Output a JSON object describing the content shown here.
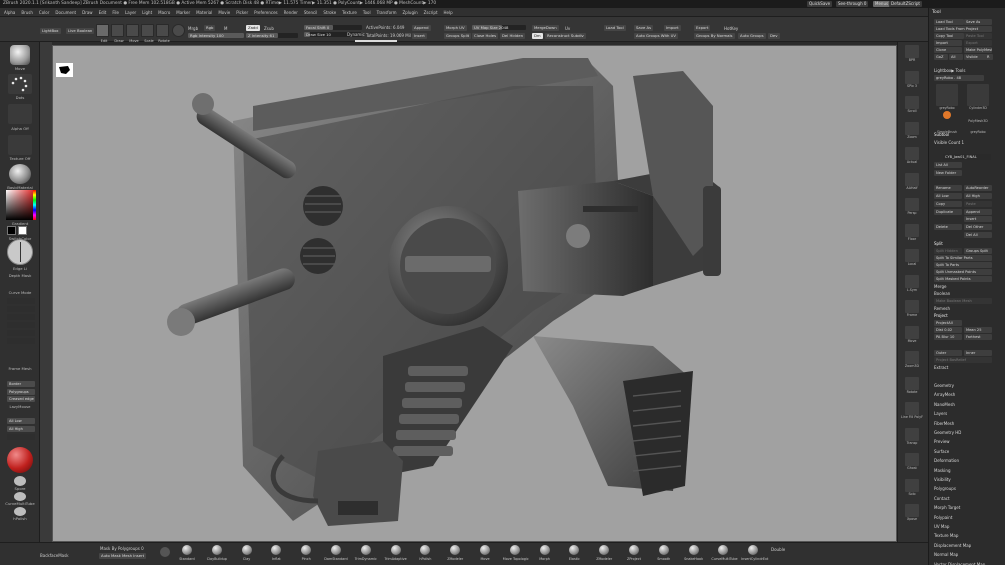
{
  "titlebar": {
    "title": "ZBrush 2020.1.1 [Srikanth Sandeep]   ZBrush Document    ● Free Mem 102.518GB ● Active Mem 5267 ● Scratch Disk 48 ● RTime▶ 11.575 Timer▶ 11.351 ● PolyCount▶ 1446.068 MP ● MeshCount▶ 170",
    "quicksave": "QuickSave",
    "seethrough": "See-through  0",
    "menus_label": "Menus",
    "default_script": "DefaultZScript"
  },
  "menubar": [
    "Alpha",
    "Brush",
    "Color",
    "Document",
    "Draw",
    "Edit",
    "File",
    "Layer",
    "Light",
    "Macro",
    "Marker",
    "Material",
    "Movie",
    "Picker",
    "Preferences",
    "Render",
    "Stencil",
    "Stroke",
    "Texture",
    "Tool",
    "Transform",
    "Zplugin",
    "Zscript",
    "Help"
  ],
  "topshelf": {
    "lightbox": "LightBox",
    "live_boolean": "Live Boolean",
    "edit": "Edit",
    "draw": "Draw",
    "move": "Move",
    "scale": "Scale",
    "rotate": "Rotate",
    "mrgb": "Mrgb",
    "rgb": "Rgb",
    "m": "M",
    "zadd": "Zadd",
    "zsub": "Zsub",
    "rgb_intensity": "Rgb Intensity 100",
    "z_intensity": "Z Intensity 61",
    "focal_shift": "Focal Shift 0",
    "draw_size": "Draw Size 10",
    "dynamic": "Dynamic",
    "active_points": "ActivePoints: 6.049",
    "total_points": "TotalPoints: 19.069 Mil",
    "append": "Append",
    "insert": "Insert",
    "morph_uv": "Morph UV",
    "uv_map_size": "UV Map Size 2048",
    "merge_down": "MergeDown",
    "uv": "Uv",
    "load_tool": "Load Tool",
    "save_as": "Save As",
    "import": "Import",
    "export": "Export",
    "hotkey": "HotKey",
    "save_as_2": "Save As",
    "goz": "GoZ",
    "all": "All",
    "visible": "Visible",
    "groups_split": "Groups Split",
    "close_holes": "Close Holes",
    "del_hidden": "Del Hidden",
    "dm": "Dm",
    "reconstruct": "Reconstruct Subdiv",
    "auto_groups_uv": "Auto Groups With UV",
    "groups_by_normals": "Groups By Normals",
    "auto_groups": "Auto Groups",
    "dev": "Dev"
  },
  "leftshelf": {
    "brush_label": "Move",
    "stroke_label": "Dots",
    "alpha_label": "Alpha Off",
    "texture_label": "Texture Off",
    "material_label": "BasicMaterial",
    "gradient_label": "Gradient",
    "switch_color": "SwitchColor",
    "alternate": "Alternate",
    "edge_label": "Edge Li",
    "depth_mask": "Depth Mask",
    "curve_mode": "Curve Mode",
    "frame_mesh": "Frame Mesh",
    "border": "Border",
    "polygroups": "Polygroups",
    "creased_edge": "Creased edge",
    "lazy_mouse": "LazyMouse",
    "all_low": "All Low",
    "all_high": "All High",
    "spore": "Spore",
    "curve_multi_tube": "CurveMultiTube",
    "hpolish": "hPolish"
  },
  "rightshelf": [
    "BPR",
    "SPix 3",
    "Scroll",
    "Zoom",
    "Actual",
    "AAHalf",
    "Persp",
    "Floor",
    "Local",
    "L.Sym",
    "Frame",
    "Move",
    "Zoom3D",
    "Rotate",
    "Line Fill PolyF",
    "Transp",
    "Ghost",
    "Solo",
    "Xpose"
  ],
  "tray": {
    "title": "Tool",
    "top_buttons": [
      "Load Tool",
      "Save As",
      "Load Tools From Project",
      "Copy Tool",
      "Paste Tool",
      "Import",
      "Export",
      "Clone",
      "Make PolyMesh3D",
      "GoZ",
      "All",
      "Visible",
      "R"
    ],
    "lightbox_tools": "Lightbox▶ Tools",
    "greyrobo": "greyRobo . 48",
    "thumbs": [
      "greyRobo",
      "Cylinder3D",
      "PolyMesh3D",
      "SimpleBrush",
      "greyRobo"
    ],
    "subtool_header": "Subtool",
    "visible_count": "Visible Count 1",
    "subtool_name": "CYB_Jaw01_FINAL",
    "list_all": "List All",
    "new_folder": "New Folder",
    "rename": "Rename",
    "autoreorder": "AutoReorder",
    "all_low": "All Low",
    "all_high": "All High",
    "copy": "Copy",
    "paste": "Paste",
    "duplicate": "Duplicate",
    "append": "Append",
    "insert": "Insert",
    "delete": "Delete",
    "del_other": "Del Other",
    "del_all": "Del All",
    "split_section": "Split",
    "split_hidden": "Split Hidden",
    "groups_split": "Groups Split",
    "split_similar": "Split To Similar Parts",
    "split_parts": "Split To Parts",
    "split_unmasked": "Split Unmasked Points",
    "split_masked": "Split Masked Points",
    "merge": "Merge",
    "boolean": "Boolean",
    "make_boolean_mesh": "Make Boolean Mesh",
    "remesh": "Remesh",
    "project": "Project",
    "project_all": "ProjectAll",
    "dist": "Dist 0.02",
    "mean": "Mean 25",
    "pa_blur": "PA Blur 10",
    "farthest": "Farthest",
    "outer": "Outer",
    "inner": "Inner",
    "project_bas_relief": "Project BasRelief",
    "extract": "Extract",
    "sections": [
      "Geometry",
      "ArrayMesh",
      "NanoMesh",
      "Layers",
      "FiberMesh",
      "Geometry HD",
      "Preview",
      "Surface",
      "Deformation",
      "Masking",
      "Visibility",
      "Polygroups",
      "Contact",
      "Morph Target",
      "Polypaint",
      "UV Map",
      "Texture Map",
      "Displacement Map",
      "Normal Map",
      "Vector Displacement Map"
    ]
  },
  "bottomshelf": {
    "mask_by_polygroups": "Mask By Polygroups 0",
    "backface_mask": "BackfaceMask",
    "auto_mask_mesh_insert": "Auto Mask Mesh Insert",
    "brushes": [
      "Standard",
      "ClayBuildup",
      "Clay",
      "Inflat",
      "Pinch",
      "DamStandard",
      "TrimDynamic",
      "TrimAdaptive",
      "hPolish",
      "ZModeler",
      "Move",
      "Move Topologic",
      "Morph",
      "Elastic",
      "ZModeler",
      "ZProject",
      "Smooth",
      "SnakeHook",
      "CurveMultiTube",
      "InsertCylindrExt"
    ],
    "double": "Double"
  },
  "colors": {
    "viewport_bg": "#a1a1a1",
    "ui_dark": "#2c2c2c",
    "accent_orange": "#e0782a"
  }
}
